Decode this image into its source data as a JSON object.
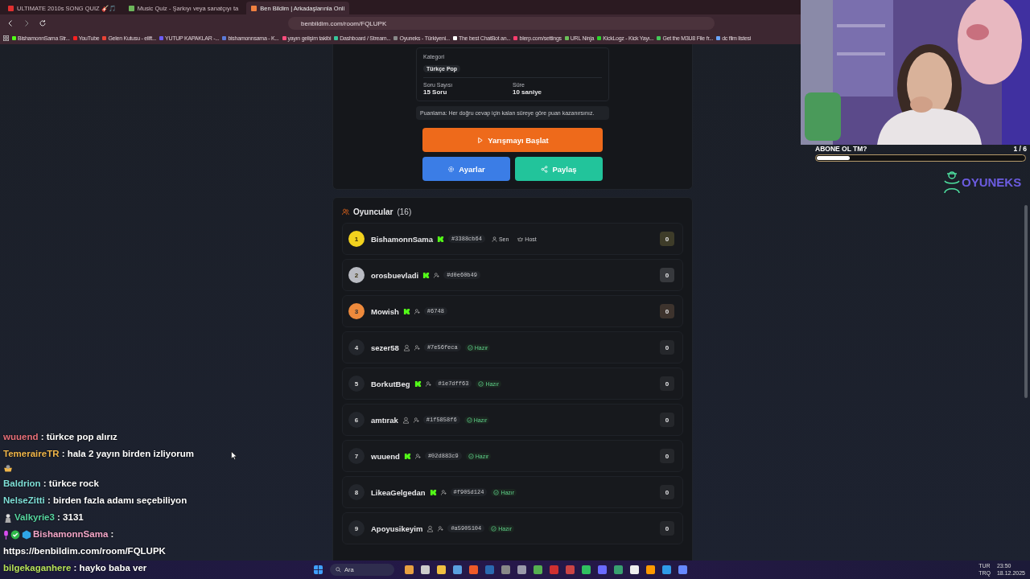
{
  "browser": {
    "tabs": [
      {
        "title": "ULTIMATE 2010s SONG QUIZ 🎸🎵",
        "selected": false
      },
      {
        "title": "Music Quiz - Şarkıyı veya sanatçıyı ta",
        "selected": false
      },
      {
        "title": "Ben Bildim | Arkadaşlarınla Onli",
        "selected": true
      }
    ],
    "url": "benbildim.com/room/FQLUPK",
    "bookmarks": [
      "BishamonnSama Str...",
      "YouTube",
      "Gelen Kutusu - elift...",
      "YUTUP KAPAKLAR -...",
      "bishamonnsama - K...",
      "yayın gelişim takibi",
      "Dashboard / Stream...",
      "Oyuneks - Türkiyeni...",
      "The best ChatBot an...",
      "blerp.com/settings",
      "URL Ninja",
      "KickLogz - Kick Yayı...",
      "Get the M3U8 File fr...",
      "dc film listesi"
    ]
  },
  "settings_card": {
    "category_label": "Kategori",
    "category": "Türkçe Pop",
    "questions_label": "Soru Sayısı",
    "questions": "15 Soru",
    "time_label": "Süre",
    "time": "10 saniye",
    "scoring_note": "Puanlama: Her doğru cevap için kalan süreye göre puan kazanırsınız.",
    "start_button": "Yarışmayı Başlat",
    "settings_button": "Ayarlar",
    "share_button": "Paylaş"
  },
  "players": {
    "title": "Oyuncular",
    "count": "(16)",
    "rows": [
      {
        "rank": "1",
        "color": "#f2d21e",
        "name": "BishamonnSama",
        "kick": true,
        "invite_icon": false,
        "tag": "#3388cb64",
        "badges": [
          {
            "kind": "you",
            "label": "Sen"
          },
          {
            "kind": "host",
            "label": "Host"
          }
        ],
        "score": "0"
      },
      {
        "rank": "2",
        "color": "#b9bbc2",
        "name": "orosbuevladi",
        "kick": true,
        "invite_icon": true,
        "tag": "#d0e60b49",
        "score": "0"
      },
      {
        "rank": "3",
        "color": "#ee8a3c",
        "name": "Mowish",
        "kick": true,
        "invite_icon": true,
        "tag": "#6748",
        "score": "0"
      },
      {
        "rank": "4",
        "color": "#23262c",
        "name": "sezer58",
        "kick": false,
        "invite_icon": true,
        "tag": "#7e56feca",
        "status": "Hazır",
        "score": "0"
      },
      {
        "rank": "5",
        "color": "#23262c",
        "name": "BorkutBeg",
        "kick": true,
        "invite_icon": true,
        "tag": "#1e7dff63",
        "status": "Hazır",
        "score": "0"
      },
      {
        "rank": "6",
        "color": "#23262c",
        "name": "amtırak",
        "kick": false,
        "invite_icon": true,
        "tag": "#1f5858f6",
        "status": "Hazır",
        "score": "0"
      },
      {
        "rank": "7",
        "color": "#23262c",
        "name": "wuuend",
        "kick": true,
        "invite_icon": true,
        "tag": "#02d883c9",
        "status": "Hazır",
        "score": "0"
      },
      {
        "rank": "8",
        "color": "#23262c",
        "name": "LikeaGelgedan",
        "kick": true,
        "invite_icon": true,
        "tag": "#f905d124",
        "status": "Hazır",
        "score": "0"
      },
      {
        "rank": "9",
        "color": "#23262c",
        "name": "Apoyusikeyim",
        "kick": false,
        "invite_icon": true,
        "tag": "#a5905104",
        "status": "Hazır",
        "score": "0"
      }
    ]
  },
  "stream_overlay": {
    "goal_title": "ABONE OL TM?",
    "goal_count": "1 / 6",
    "goal": {
      "level": 0.16
    },
    "logo_text": "OYUNEKS"
  },
  "chat": [
    {
      "kind": "message",
      "user": "wuuend",
      "color": "#e8707a",
      "text": ": türkce pop alırız"
    },
    {
      "kind": "message",
      "user": "TemeraireTR",
      "color": "#f0b64a",
      "text": ": hala 2 yayın birden izliyorum"
    },
    {
      "kind": "emote"
    },
    {
      "kind": "message",
      "user": "Baldrion",
      "color": "#7fe0d8",
      "text": ": türkce rock"
    },
    {
      "kind": "message",
      "user": "NelseZitti",
      "color": "#7fe0d8",
      "text": ": birden fazla adamı seçebiliyon"
    },
    {
      "kind": "message",
      "user": "Valkyrie3",
      "color": "#57d6a0",
      "badges": [
        {
          "kind": "figure"
        }
      ],
      "text": ": 3131"
    },
    {
      "kind": "message",
      "user": "BishamonnSama",
      "color": "#f3a6c8",
      "badges": [
        {
          "kind": "mic"
        },
        {
          "kind": "check"
        },
        {
          "kind": "cube"
        }
      ],
      "text": ": https://benbildim.com/room/FQLUPK"
    },
    {
      "kind": "message",
      "user": "bilgekaganhere",
      "color": "#b6e05a",
      "text": ": hayko baba ver"
    }
  ],
  "taskbar": {
    "search": "Ara",
    "language": "TUR",
    "layout": "TRQ",
    "time": "23:50",
    "date": "18.12.2025"
  }
}
